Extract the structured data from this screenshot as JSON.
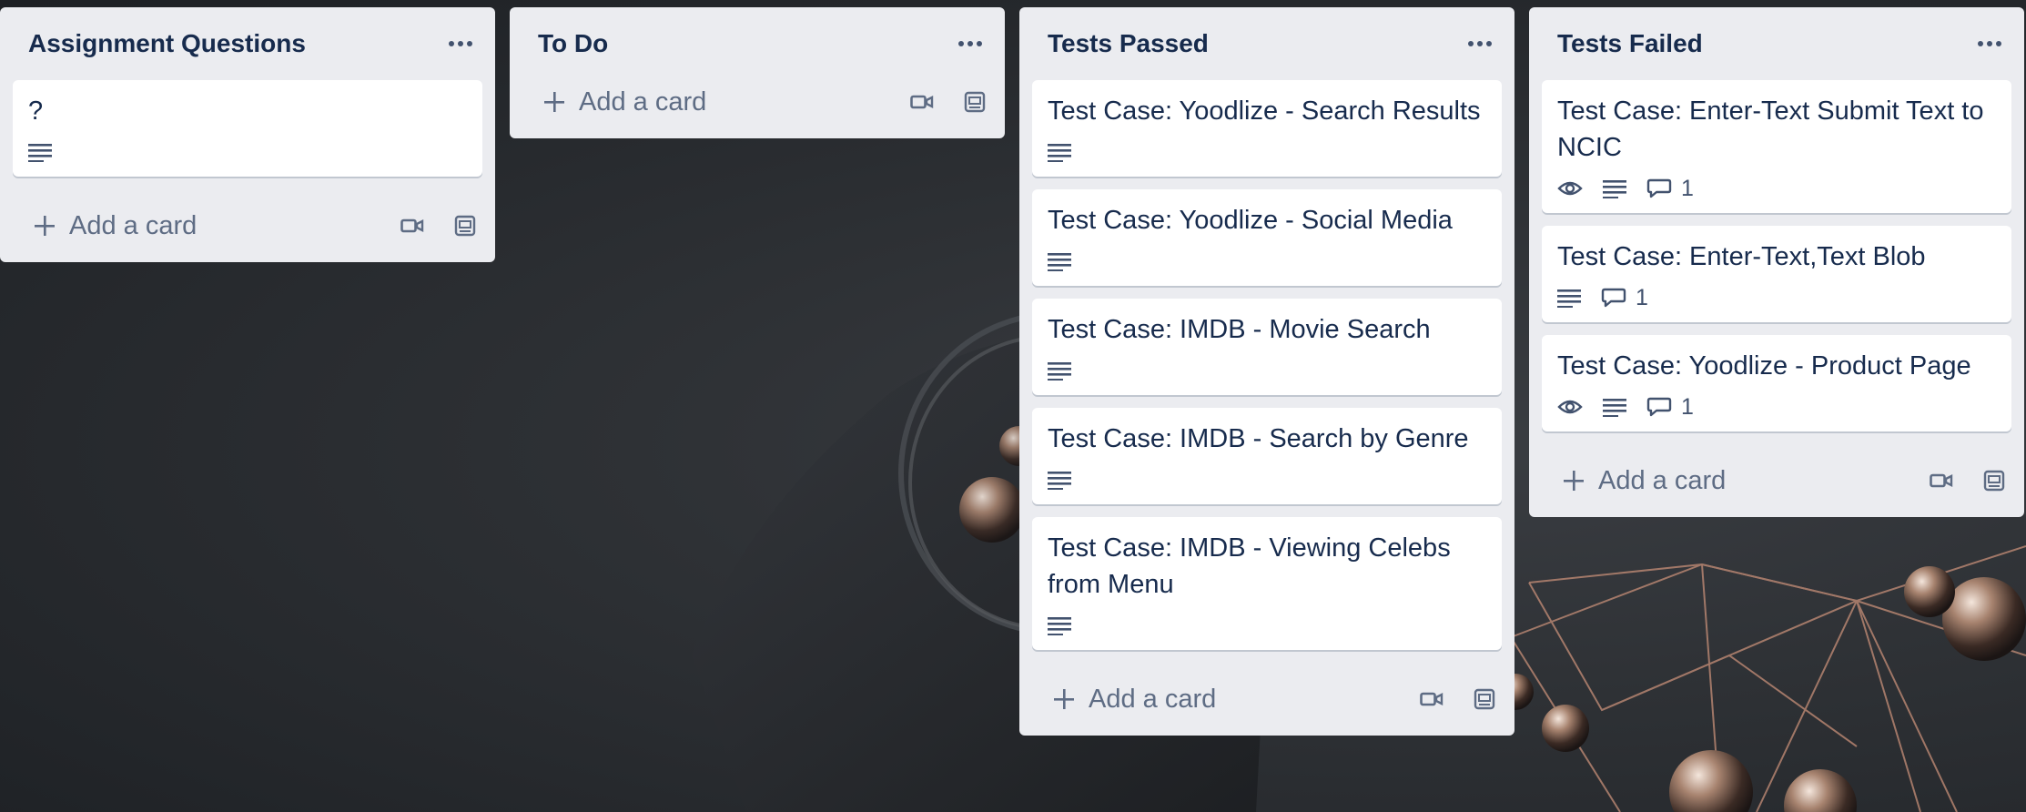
{
  "colors": {
    "list_bg": "#ebecf0",
    "card_bg": "#ffffff",
    "title_text": "#172b4d",
    "muted_text": "#5e6c84"
  },
  "lists": [
    {
      "title": "Assignment Questions",
      "cards": [
        {
          "title": "?",
          "badges": {
            "watch": false,
            "description": true,
            "comments": ""
          }
        }
      ],
      "add_card_label": "Add a card"
    },
    {
      "title": "To Do",
      "cards": [],
      "add_card_label": "Add a card"
    },
    {
      "title": "Tests Passed",
      "cards": [
        {
          "title": "Test Case: Yoodlize - Search Results",
          "badges": {
            "watch": false,
            "description": true,
            "comments": ""
          }
        },
        {
          "title": "Test Case: Yoodlize - Social Media",
          "badges": {
            "watch": false,
            "description": true,
            "comments": ""
          }
        },
        {
          "title": "Test Case: IMDB - Movie Search",
          "badges": {
            "watch": false,
            "description": true,
            "comments": ""
          }
        },
        {
          "title": "Test Case: IMDB - Search by Genre",
          "badges": {
            "watch": false,
            "description": true,
            "comments": ""
          }
        },
        {
          "title": "Test Case: IMDB - Viewing Celebs from Menu",
          "badges": {
            "watch": false,
            "description": true,
            "comments": ""
          }
        }
      ],
      "add_card_label": "Add a card"
    },
    {
      "title": "Tests Failed",
      "cards": [
        {
          "title": "Test Case: Enter-Text Submit Text to NCIC",
          "badges": {
            "watch": true,
            "description": true,
            "comments": "1"
          }
        },
        {
          "title": "Test Case: Enter-Text,Text Blob",
          "badges": {
            "watch": false,
            "description": true,
            "comments": "1"
          }
        },
        {
          "title": "Test Case: Yoodlize - Product Page",
          "badges": {
            "watch": true,
            "description": true,
            "comments": "1"
          }
        }
      ],
      "add_card_label": "Add a card"
    }
  ],
  "icons": {
    "list_menu": "more-horizontal-icon",
    "description": "description-lines-icon",
    "watch": "eye-icon",
    "comment": "comment-bubble-icon",
    "add": "plus-icon",
    "record_video": "video-camera-icon",
    "template": "card-template-icon"
  }
}
